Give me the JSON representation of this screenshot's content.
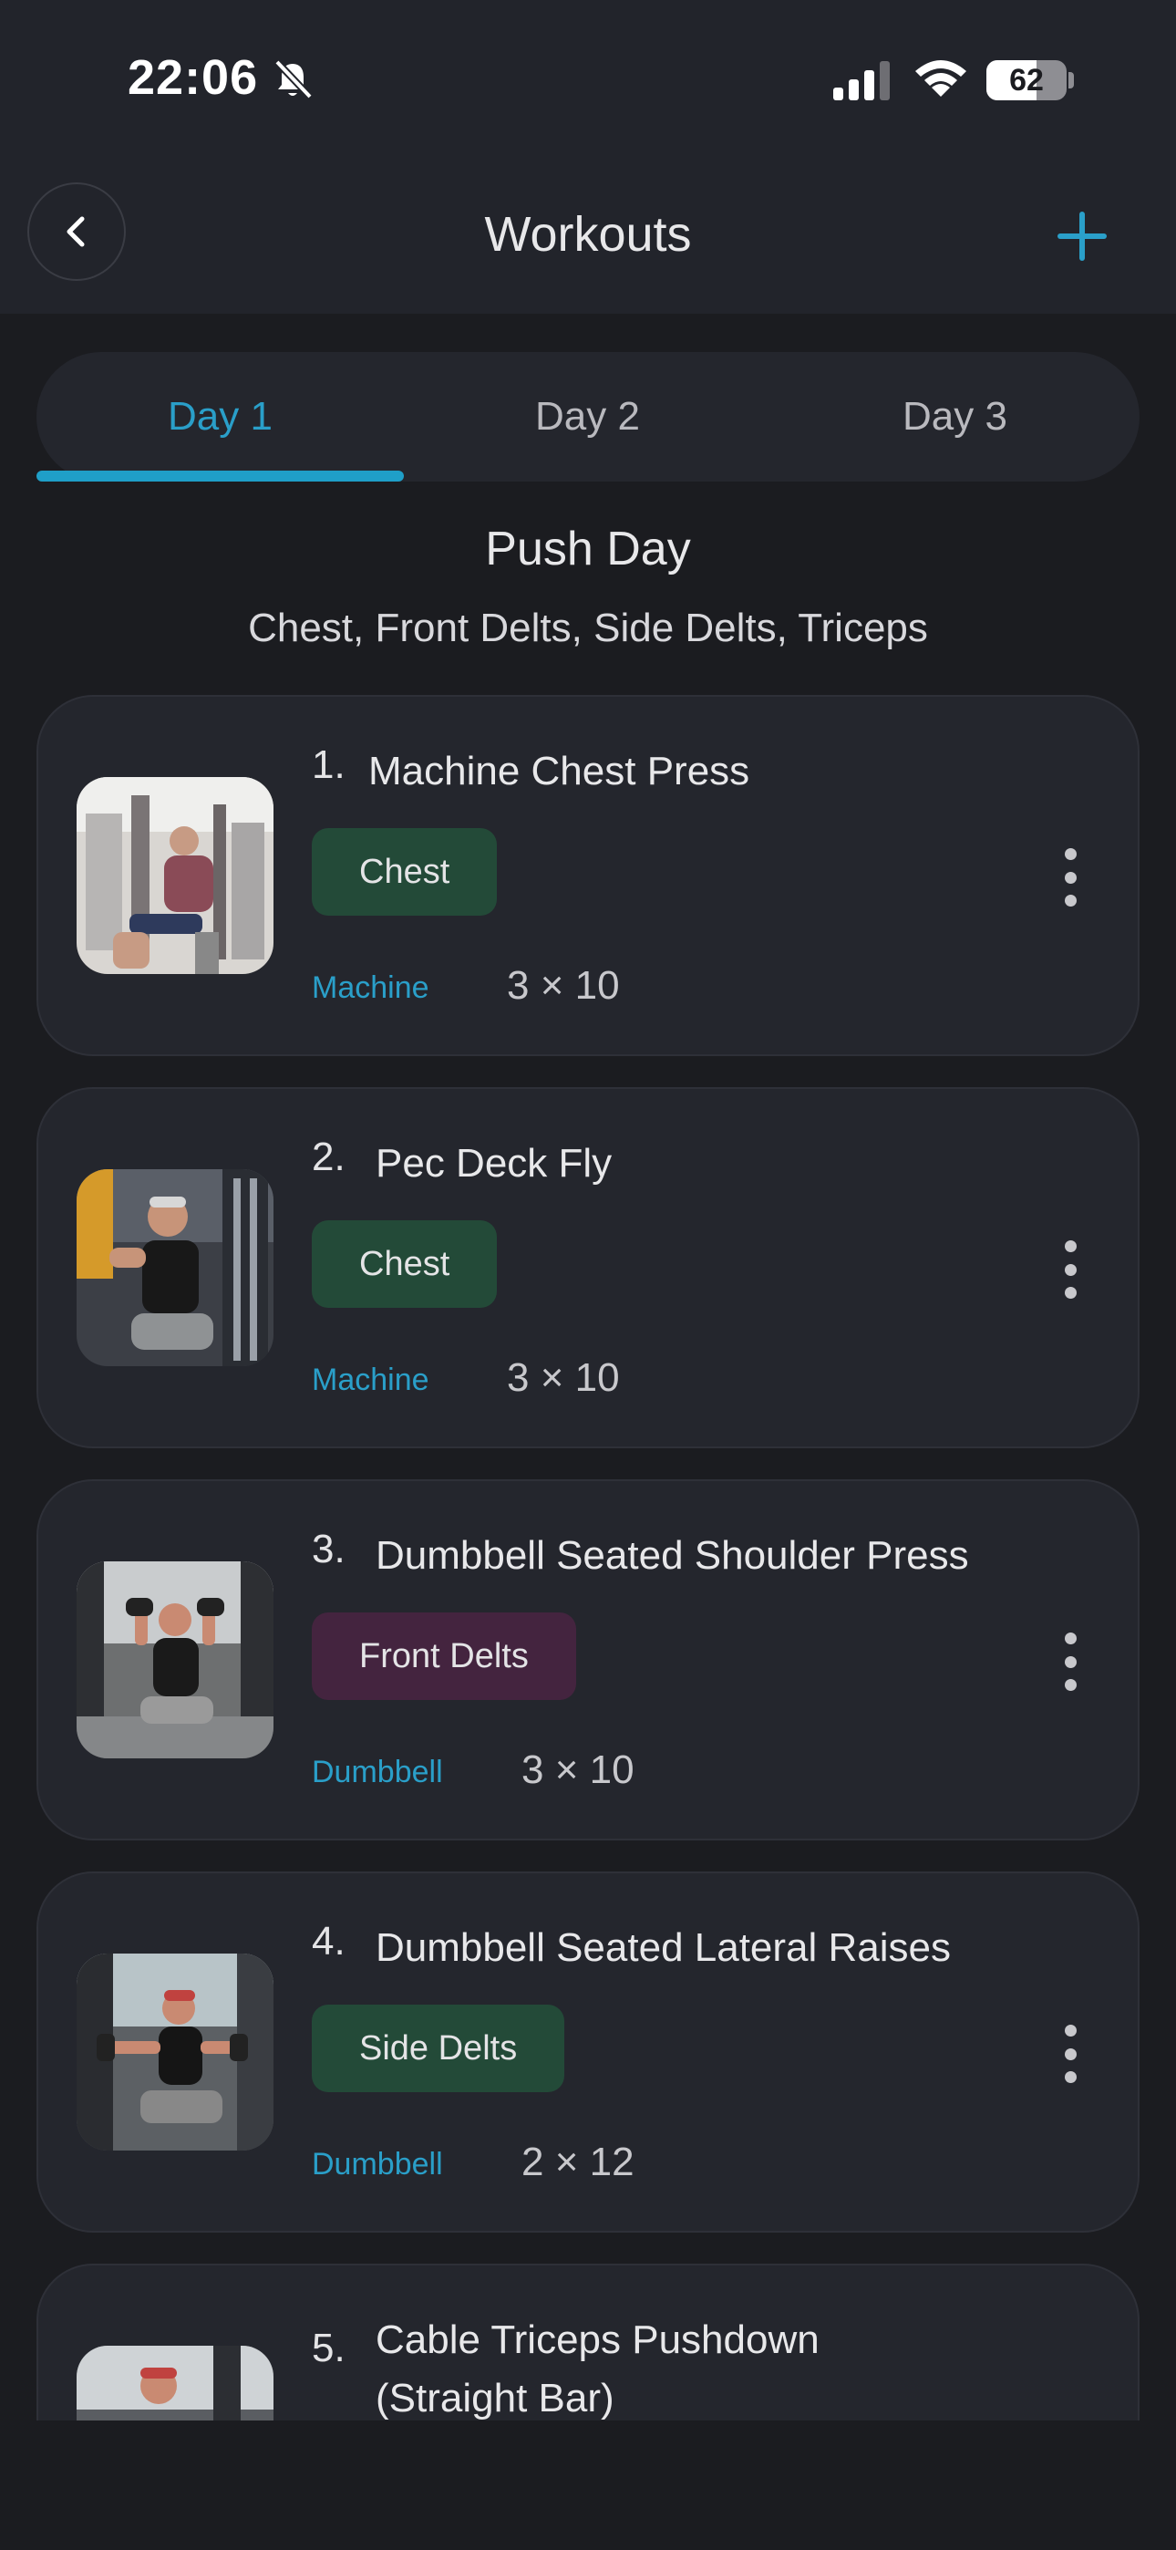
{
  "status": {
    "time": "22:06",
    "battery": "62",
    "battery_level": 0.62
  },
  "nav": {
    "title": "Workouts",
    "back_icon": "chevron-left-icon",
    "add_icon": "plus-icon",
    "accent": "#2a9fc9"
  },
  "tabs": [
    {
      "label": "Day 1",
      "active": true
    },
    {
      "label": "Day 2",
      "active": false
    },
    {
      "label": "Day 3",
      "active": false
    }
  ],
  "day": {
    "title": "Push Day",
    "subtitle": "Chest, Front Delts, Side Delts, Triceps"
  },
  "exercises": [
    {
      "num": "1.",
      "name": "Machine Chest Press",
      "tag": "Chest",
      "tag_color": "#234a38",
      "equipment": "Machine",
      "sets": "3 × 10"
    },
    {
      "num": "2.",
      "name": "Pec Deck Fly",
      "tag": "Chest",
      "tag_color": "#234a38",
      "equipment": "Machine",
      "sets": "3 × 10"
    },
    {
      "num": "3.",
      "name": "Dumbbell Seated Shoulder Press",
      "tag": "Front Delts",
      "tag_color": "#44243f",
      "equipment": "Dumbbell",
      "sets": "3 × 10"
    },
    {
      "num": "4.",
      "name": "Dumbbell Seated Lateral Raises",
      "tag": "Side Delts",
      "tag_color": "#234a38",
      "equipment": "Dumbbell",
      "sets": "2 × 12"
    },
    {
      "num": "5.",
      "name": "Cable Triceps Pushdown (Straight Bar)",
      "tag": "",
      "tag_color": "#234a38",
      "equipment": "",
      "sets": ""
    }
  ]
}
